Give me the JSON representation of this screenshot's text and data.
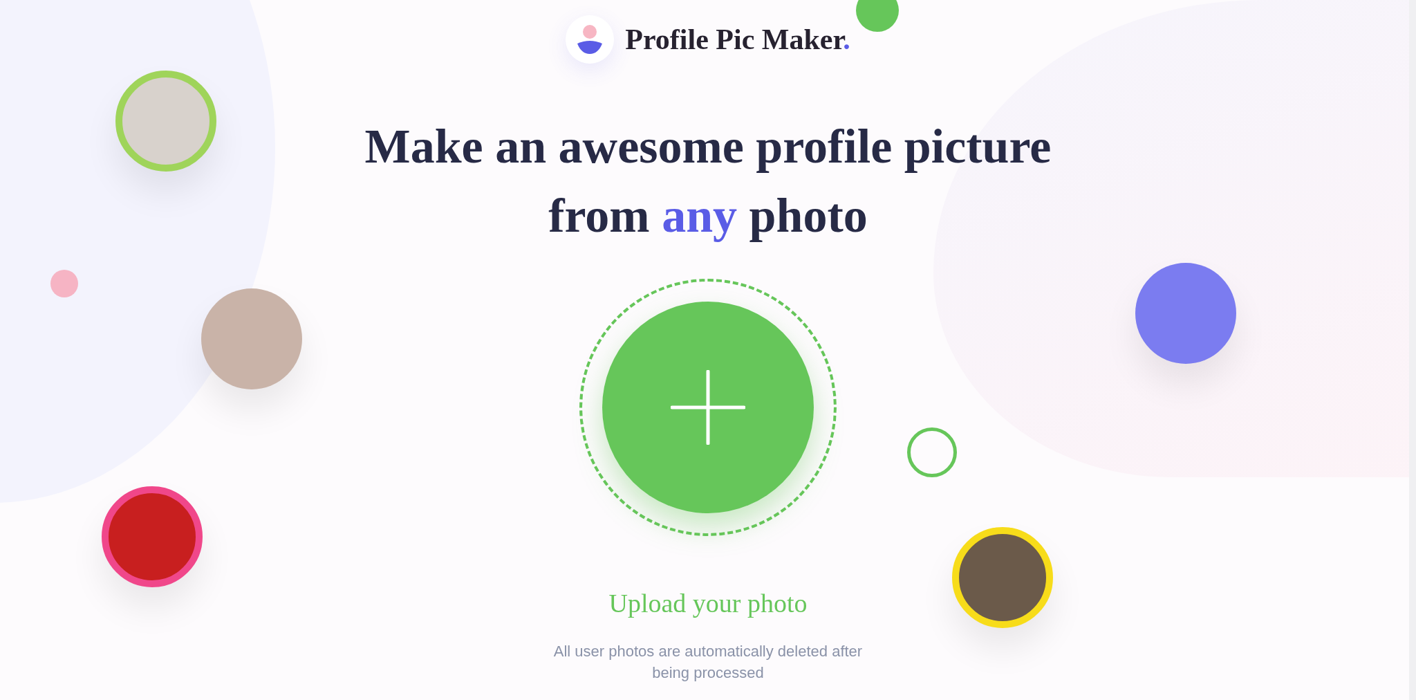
{
  "logo": {
    "text": "Profile Pic Maker",
    "dot": "."
  },
  "headline": [
    {
      "text": "Make an awesome profile picture from ",
      "accent": false
    },
    {
      "text": "any",
      "accent": true
    },
    {
      "text": " photo",
      "accent": false
    }
  ],
  "upload": {
    "label": "Upload your photo",
    "note": "All user photos are automatically deleted after being processed"
  }
}
